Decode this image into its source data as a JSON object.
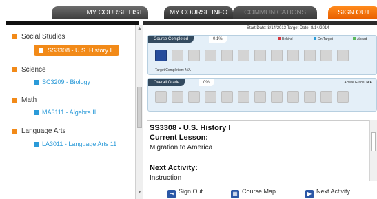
{
  "tabs": {
    "course_list": "MY COURSE LIST",
    "course_info": "MY COURSE INFO",
    "communications": "COMMUNICATIONS",
    "sign_out": "SIGN OUT"
  },
  "sidebar": {
    "groups": [
      {
        "subject": "Social Studies",
        "courses": [
          "SS3308 - U.S. History I"
        ]
      },
      {
        "subject": "Science",
        "courses": [
          "SC3209 - Biology"
        ]
      },
      {
        "subject": "Math",
        "courses": [
          "MA3111 - Algebra II"
        ]
      },
      {
        "subject": "Language Arts",
        "courses": [
          "LA3011 - Language Arts 11"
        ]
      }
    ]
  },
  "dates": {
    "text": "Start Date: 8/14/2013  Target Date: 8/14/2014"
  },
  "progress": {
    "course_completed_label": "Course Completed",
    "course_completed_value": "0.1%",
    "legend_behind": "Behind",
    "legend_on_target": "On Target",
    "legend_ahead": "Ahead",
    "target_completion": "Target Completion: N/A",
    "colors": {
      "behind": "#d9363e",
      "on_target": "#2a9ad8",
      "ahead": "#5cb85c",
      "filled": "#274d9c"
    }
  },
  "grade": {
    "overall_label": "Overall Grade",
    "overall_value": "0%",
    "actual_label": "Actual Grade:",
    "actual_value": "N/A"
  },
  "course_info": {
    "title": "SS3308 - U.S. History I",
    "current_lesson_label": "Current Lesson:",
    "current_lesson": "Migration to America",
    "next_activity_label": "Next Activity:",
    "next_activity": "Instruction"
  },
  "footer": {
    "sign_out": "Sign Out",
    "course_map": "Course Map",
    "next_activity": "Next Activity"
  }
}
